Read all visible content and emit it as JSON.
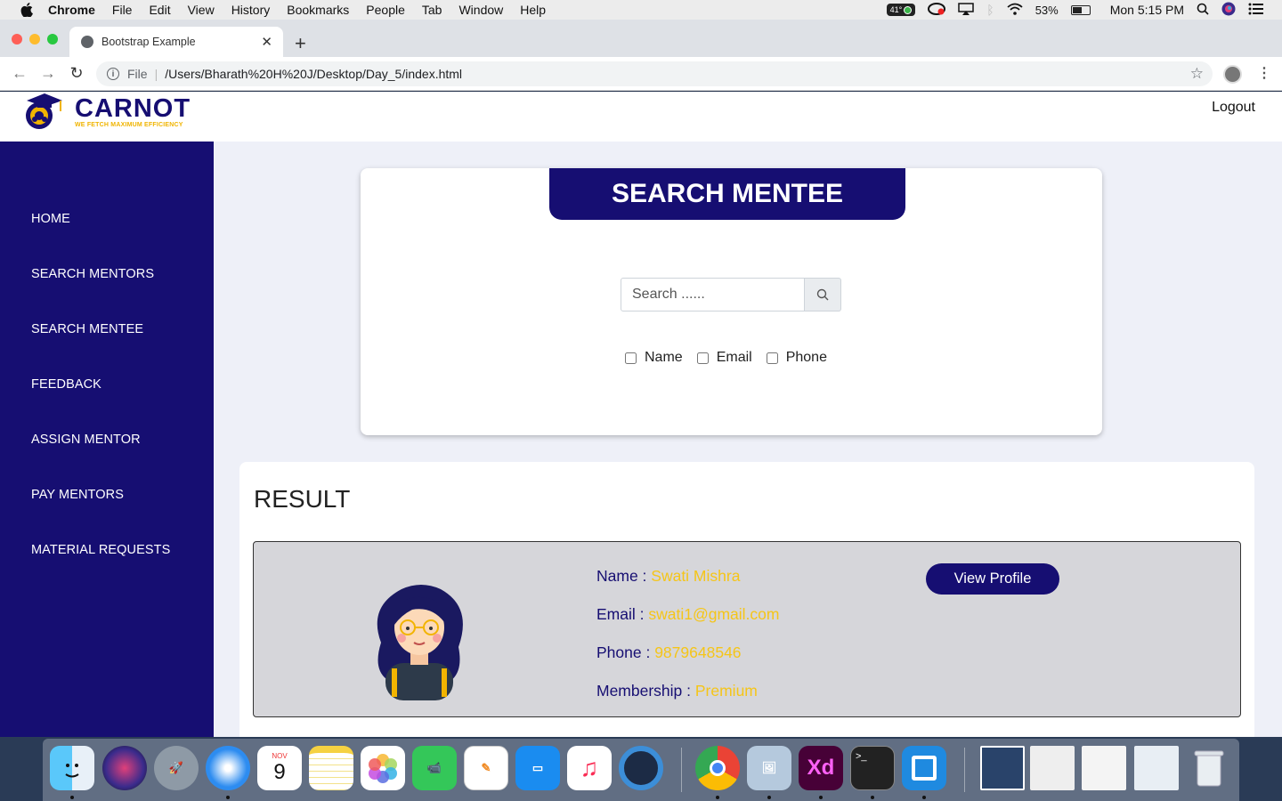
{
  "menubar": {
    "app": "Chrome",
    "items": [
      "File",
      "Edit",
      "View",
      "History",
      "Bookmarks",
      "People",
      "Tab",
      "Window",
      "Help"
    ],
    "temp": "41°",
    "battery": "53%",
    "clock": "Mon 5:15 PM"
  },
  "browser": {
    "tab_title": "Bootstrap Example",
    "scheme": "File",
    "url": "/Users/Bharath%20H%20J/Desktop/Day_5/index.html"
  },
  "header": {
    "brand": "CARNOT",
    "tagline": "WE FETCH MAXIMUM EFFICIENCY",
    "logout": "Logout"
  },
  "sidebar": {
    "items": [
      "HOME",
      "SEARCH MENTORS",
      "SEARCH MENTEE",
      "FEEDBACK",
      "ASSIGN MENTOR",
      "PAY MENTORS",
      "MATERIAL REQUESTS"
    ]
  },
  "search": {
    "title": "SEARCH MENTEE",
    "placeholder": "Search ......",
    "filters": [
      "Name",
      "Email",
      "Phone"
    ]
  },
  "result": {
    "title": "RESULT",
    "mentee": {
      "name_label": "Name : ",
      "name": "Swati Mishra",
      "email_label": "Email : ",
      "email": "swati1@gmail.com",
      "phone_label": "Phone : ",
      "phone": "9879648546",
      "membership_label": "Membership : ",
      "membership": "Premium"
    },
    "view_profile": "View Profile"
  },
  "calendar_icon": {
    "month": "NOV",
    "day": "9"
  },
  "colors": {
    "primary": "#160e72",
    "accent": "#f5c518",
    "page_bg": "#eef0f8",
    "card_bg": "#d6d6da"
  }
}
